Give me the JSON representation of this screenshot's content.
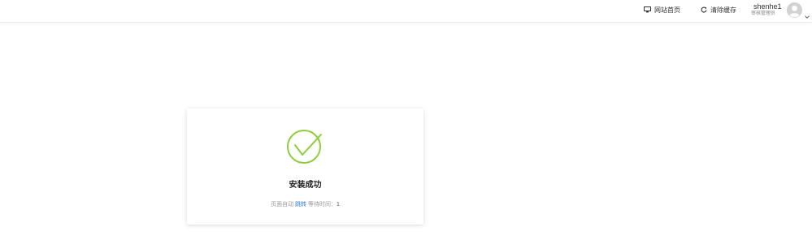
{
  "header": {
    "site_home_label": "网站首页",
    "site_home_icon": "monitor-icon",
    "clear_cache_label": "清除缓存",
    "clear_cache_icon": "refresh-icon",
    "user": {
      "name": "shenhe1",
      "role": "审核管理员",
      "avatar_icon": "user-avatar-icon",
      "dropdown_icon": "chevron-down-icon"
    }
  },
  "message": {
    "icon": "check-circle-icon",
    "icon_color": "#8ccf3a",
    "title": "安装成功",
    "note_prefix": "页面自动",
    "jump_label": "跳转",
    "note_wait": "等待时间：",
    "wait_seconds": "1"
  },
  "colors": {
    "link": "#2d7bd3",
    "success": "#8ccf3a"
  }
}
